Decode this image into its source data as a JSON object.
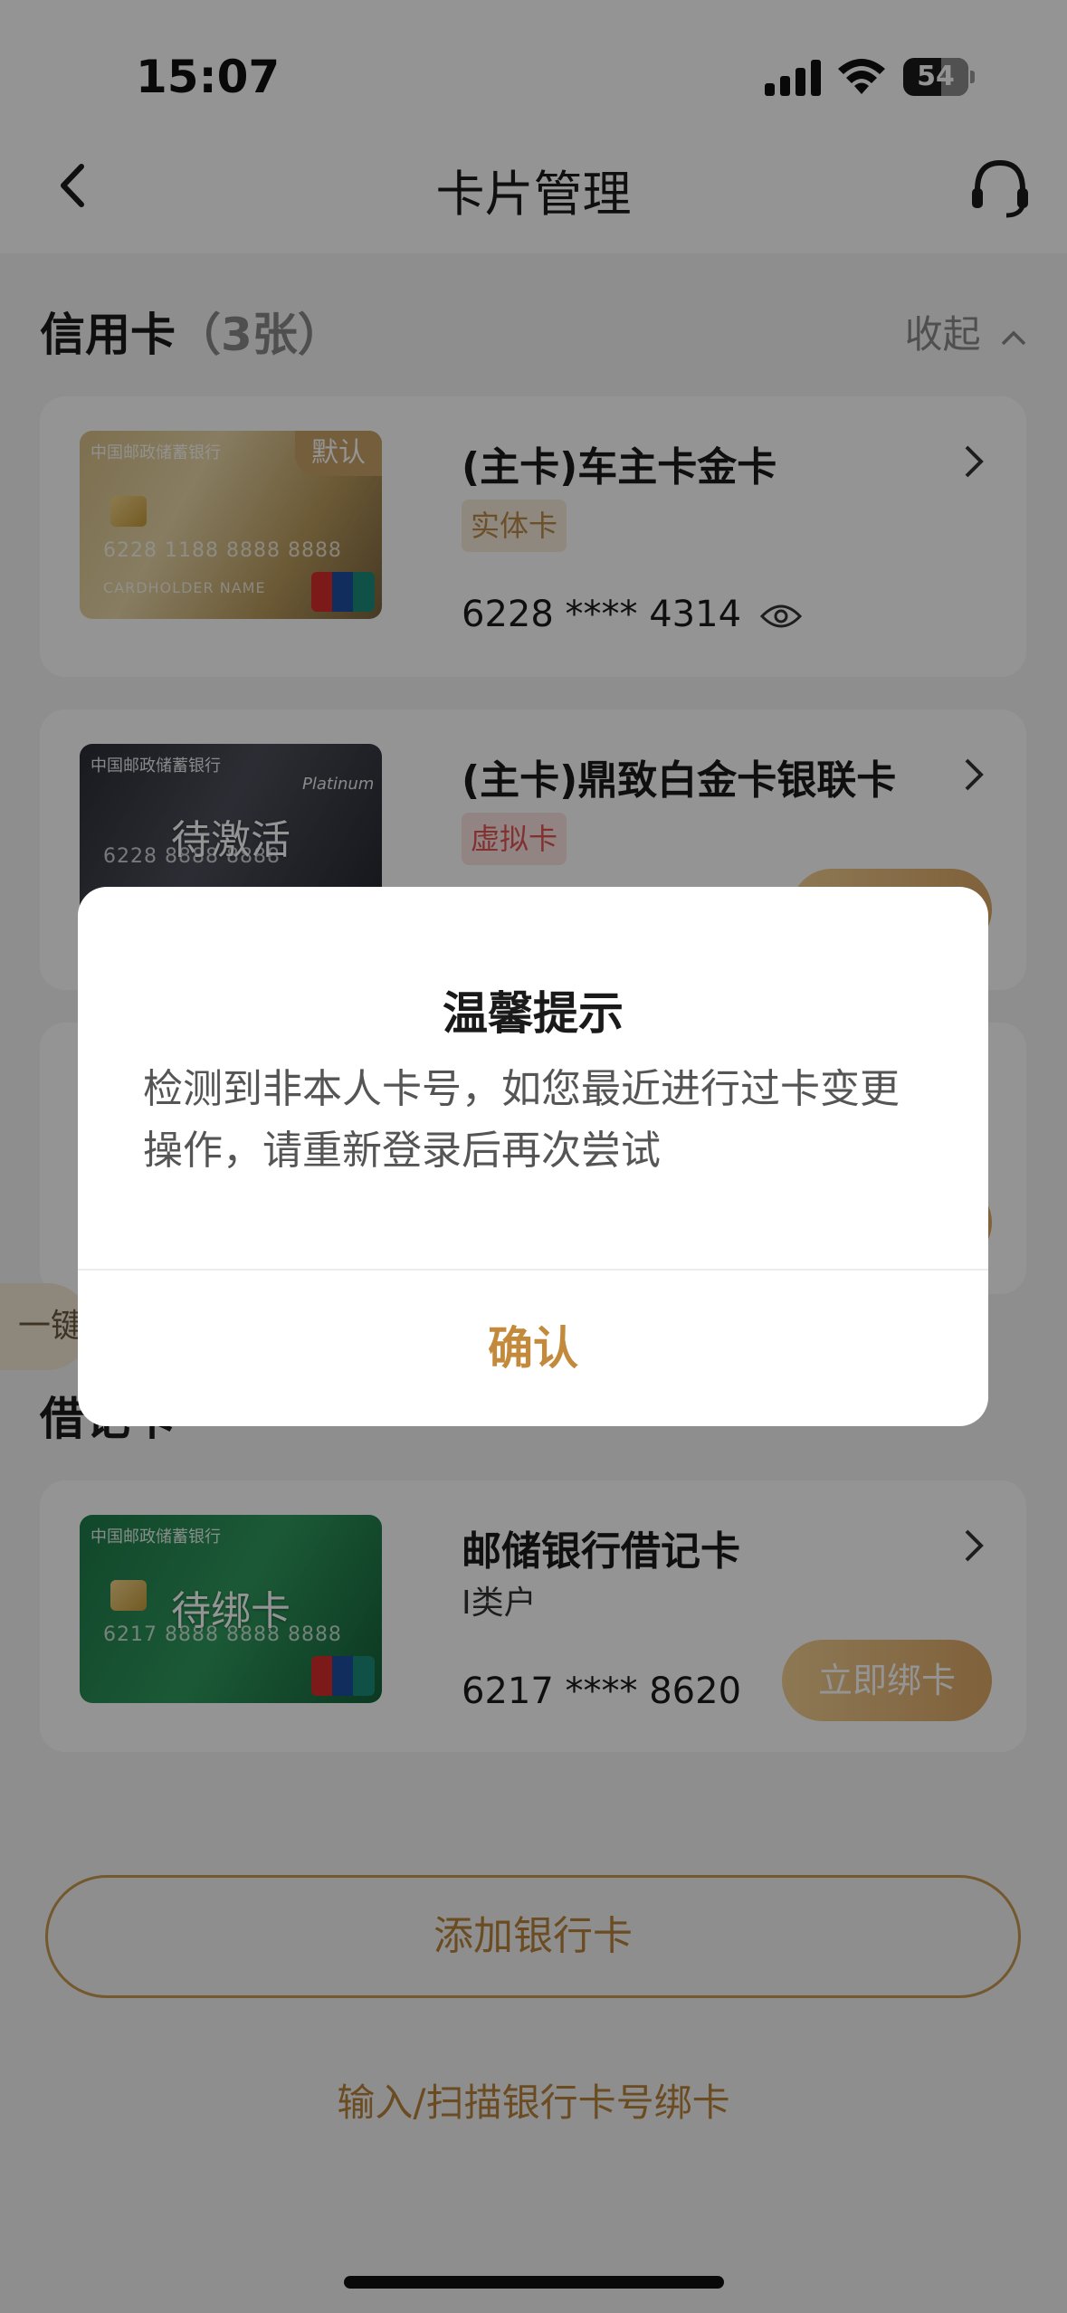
{
  "status_bar": {
    "time": "15:07",
    "battery": "54"
  },
  "nav": {
    "title": "卡片管理"
  },
  "credit": {
    "title": "信用卡",
    "count": "（3张）",
    "collapse_label": "收起",
    "cards": [
      {
        "name": "(主卡)车主卡金卡",
        "tag": "实体卡",
        "number": "6228 **** 4314",
        "badge": "默认",
        "bank": "中国邮政储蓄银行",
        "art_digits": "6228 1188 8888 8888",
        "holder": "CARDHOLDER NAME"
      },
      {
        "name": "(主卡)鼎致白金卡银联卡",
        "tag": "虚拟卡",
        "overlay": "待激活",
        "bank": "中国邮政储蓄银行",
        "art_digits": "6228 8888 8888",
        "art_sub": "Platinum"
      }
    ]
  },
  "side_tab": "一键",
  "debit": {
    "title": "借记卡",
    "cards": [
      {
        "name": "邮储银行借记卡",
        "sub": "I类户",
        "number": "6217 **** 8620",
        "overlay": "待绑卡",
        "action": "立即绑卡",
        "bank": "中国邮政储蓄银行",
        "art_digits": "6217 8888 8888 8888"
      }
    ]
  },
  "actions": {
    "add_card": "添加银行卡",
    "scan_link": "输入/扫描银行卡号绑卡"
  },
  "dialog": {
    "title": "温馨提示",
    "message": "检测到非本人卡号，如您最近进行过卡变更操作，请重新登录后再次尝试",
    "confirm": "确认"
  },
  "colors": {
    "accent": "#c48a3c",
    "gold_button": "#dca866",
    "virtual_tag": "#e05555",
    "real_tag": "#b88a4a"
  }
}
